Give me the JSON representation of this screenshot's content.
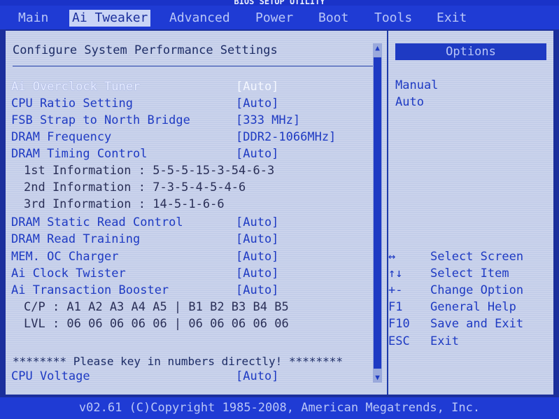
{
  "title": "BIOS SETUP UTILITY",
  "menu": [
    {
      "label": "Main",
      "active": false
    },
    {
      "label": "Ai Tweaker",
      "active": true
    },
    {
      "label": "Advanced",
      "active": false
    },
    {
      "label": "Power",
      "active": false
    },
    {
      "label": "Boot",
      "active": false
    },
    {
      "label": "Tools",
      "active": false
    },
    {
      "label": "Exit",
      "active": false
    }
  ],
  "heading": "Configure System Performance Settings",
  "rows": [
    {
      "label": "Ai Overclock Tuner",
      "value": "[Auto]",
      "kind": "sel"
    },
    {
      "label": "CPU Ratio Setting",
      "value": "[Auto]",
      "kind": "item"
    },
    {
      "label": "FSB Strap to North Bridge",
      "value": "[333 MHz]",
      "kind": "item"
    },
    {
      "label": "DRAM Frequency",
      "value": "[DDR2-1066MHz]",
      "kind": "item"
    },
    {
      "label": "DRAM Timing Control",
      "value": "[Auto]",
      "kind": "item"
    },
    {
      "label": "1st Information : 5-5-5-15-3-54-6-3",
      "value": "",
      "kind": "info"
    },
    {
      "label": "2nd Information : 7-3-5-4-5-4-6",
      "value": "",
      "kind": "info"
    },
    {
      "label": "3rd Information : 14-5-1-6-6",
      "value": "",
      "kind": "info"
    },
    {
      "label": "DRAM Static Read Control",
      "value": "[Auto]",
      "kind": "item"
    },
    {
      "label": "DRAM Read Training",
      "value": "[Auto]",
      "kind": "item"
    },
    {
      "label": "MEM. OC Charger",
      "value": "[Auto]",
      "kind": "item"
    },
    {
      "label": "Ai Clock Twister",
      "value": "[Auto]",
      "kind": "item"
    },
    {
      "label": "Ai Transaction Booster",
      "value": "[Auto]",
      "kind": "item"
    },
    {
      "label": "C/P : A1 A2 A3 A4 A5 | B1 B2 B3 B4 B5",
      "value": "",
      "kind": "data"
    },
    {
      "label": "LVL : 06 06 06 06 06 | 06 06 06 06 06",
      "value": "",
      "kind": "data"
    }
  ],
  "notice": "******** Please key in numbers directly! ********",
  "voltage": {
    "label": "CPU Voltage",
    "value": "[Auto]"
  },
  "options_header": "Options",
  "options": [
    "Manual",
    "Auto"
  ],
  "keys": [
    {
      "key": "↔",
      "desc": "Select Screen"
    },
    {
      "key": "↑↓",
      "desc": "Select Item"
    },
    {
      "key": "+-",
      "desc": "Change Option"
    },
    {
      "key": "F1",
      "desc": "General Help"
    },
    {
      "key": "F10",
      "desc": "Save and Exit"
    },
    {
      "key": "ESC",
      "desc": "Exit"
    }
  ],
  "footer": "v02.61 (C)Copyright 1985-2008, American Megatrends, Inc.",
  "colors": {
    "background": "#1b2f9c",
    "panel": "#c3cde9",
    "accent": "#1e3ac3"
  }
}
